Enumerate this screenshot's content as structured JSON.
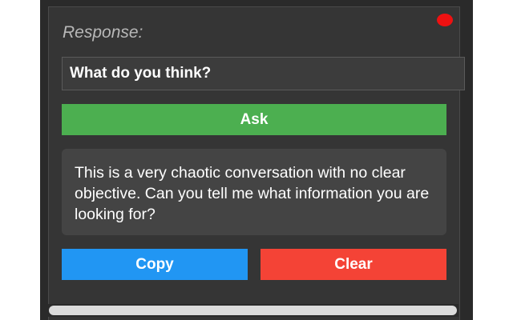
{
  "widget": {
    "response_label": "Response:",
    "input_value": "What do you think?",
    "ask_label": "Ask",
    "answer_text": "This is a very chaotic conversation with no clear objective. Can you tell me what information you are looking for?",
    "copy_label": "Copy",
    "clear_label": "Clear"
  },
  "colors": {
    "ask": "#4caf50",
    "copy": "#2196f3",
    "clear": "#f44336",
    "status_dot": "#ee1111",
    "panel": "#353535"
  },
  "icons": {
    "status_dot": "red-status-dot"
  }
}
